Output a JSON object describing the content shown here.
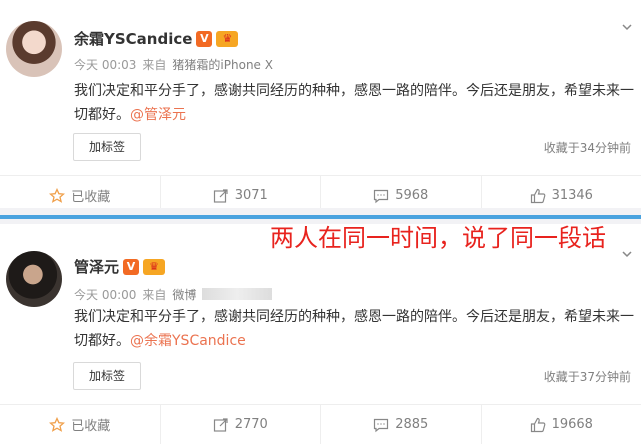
{
  "posts": [
    {
      "author": "余霜YSCandice",
      "time": "今天 00:03",
      "source_prefix": "来自",
      "source": "猪猪霜的iPhone X",
      "text_main": "我们决定和平分手了，感谢共同经历的种种，感恩一路的陪伴。今后还是朋友，希望未来一切都好。",
      "mention": "@管泽元",
      "tag_button": "加标签",
      "fav_time": "收藏于34分钟前",
      "actions": {
        "favorite": "已收藏",
        "repost": "3071",
        "comment": "5968",
        "like": "31346"
      }
    },
    {
      "author": "管泽元",
      "time": "今天 00:00",
      "source_prefix": "来自",
      "source": "微博",
      "text_main": "我们决定和平分手了，感谢共同经历的种种，感恩一路的陪伴。今后还是朋友，希望未来一切都好。",
      "mention": "@余霜YSCandice",
      "tag_button": "加标签",
      "fav_time": "收藏于37分钟前",
      "actions": {
        "favorite": "已收藏",
        "repost": "2770",
        "comment": "2885",
        "like": "19668"
      }
    }
  ],
  "annotation": "两人在同一时间，说了同一段话",
  "badges": {
    "verified": "V",
    "crown": "♛"
  },
  "colors": {
    "accent": "#eb7350",
    "divider_blue": "#4aa3df",
    "annotation_red": "#e8231e"
  }
}
